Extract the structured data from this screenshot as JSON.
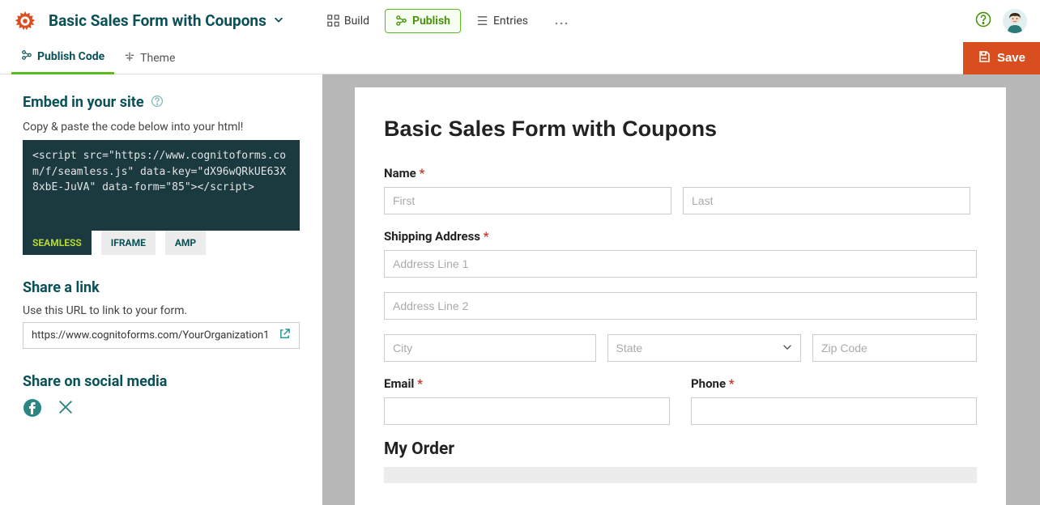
{
  "header": {
    "form_title": "Basic Sales Form with Coupons",
    "nav": {
      "build": "Build",
      "publish": "Publish",
      "entries": "Entries"
    }
  },
  "subnav": {
    "publish_code": "Publish Code",
    "theme": "Theme",
    "save": "Save"
  },
  "sidebar": {
    "embed": {
      "title": "Embed in your site",
      "subtitle": "Copy & paste the code below into your html!",
      "code": "<script src=\"https://www.cognitoforms.com/f/seamless.js\" data-key=\"dX96wQRkUE63X8xbE-JuVA\" data-form=\"85\"></script>",
      "tabs": {
        "seamless": "SEAMLESS",
        "iframe": "IFRAME",
        "amp": "AMP"
      }
    },
    "share_link": {
      "title": "Share a link",
      "subtitle": "Use this URL to link to your form.",
      "url": "https://www.cognitoforms.com/YourOrganization1"
    },
    "social": {
      "title": "Share on social media"
    }
  },
  "form": {
    "title": "Basic Sales Form with Coupons",
    "name_label": "Name",
    "first_ph": "First",
    "last_ph": "Last",
    "shipping_label": "Shipping Address",
    "addr1_ph": "Address Line 1",
    "addr2_ph": "Address Line 2",
    "city_ph": "City",
    "state_ph": "State",
    "zip_ph": "Zip Code",
    "email_label": "Email",
    "phone_label": "Phone",
    "order_heading": "My Order"
  }
}
